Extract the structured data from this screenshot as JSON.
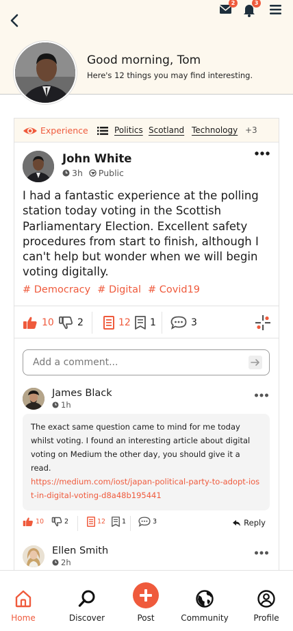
{
  "header": {
    "greeting": "Good morning, Tom",
    "subtitle": "Here's 12 things you may find interesting.",
    "messages_badge": "2",
    "notifications_badge": "3",
    "icons": [
      "back-icon",
      "mail-icon",
      "bell-icon",
      "menu-icon"
    ]
  },
  "filters": {
    "view_label": "Experience",
    "tags": [
      "Politics",
      "Scotland",
      "Technology"
    ],
    "more": "+3"
  },
  "post": {
    "author": "John White",
    "time": "3h",
    "visibility": "Public",
    "text": "I had a fantastic experience at the polling station today voting in the Scottish Parliamentary Election. Excellent safety procedures from start to finish, although I can't help but wonder when we will begin voting digitally.",
    "hashtags": [
      "# Democracy",
      "# Digital",
      "# Covid19"
    ],
    "likes": "10",
    "dislikes": "2",
    "saves": "12",
    "archives": "1",
    "comments": "3"
  },
  "comment_input": {
    "placeholder": "Add a comment..."
  },
  "comments": [
    {
      "author": "James Black",
      "time": "1h",
      "text": "The exact same question came to mind for me today whilst voting. I found an interesting article about digital voting on Medium the other day, you should give it a read.",
      "link": "https://medium.com/iost/japan-political-party-to-adopt-iost-in-digital-voting-d8a48b195441",
      "likes": "10",
      "dislikes": "2",
      "saves": "12",
      "archives": "1",
      "comments": "3",
      "reply_label": "Reply"
    },
    {
      "author": "Ellen Smith",
      "time": "2h"
    }
  ],
  "nav": [
    {
      "label": "Home",
      "icon": "home-icon"
    },
    {
      "label": "Discover",
      "icon": "search-icon"
    },
    {
      "label": "Post",
      "icon": "plus-icon"
    },
    {
      "label": "Community",
      "icon": "globe-icon"
    },
    {
      "label": "Profile",
      "icon": "user-icon"
    }
  ],
  "colors": {
    "accent": "#ef5a3c",
    "header_bg": "#fdf8ee",
    "text": "#1b1b1b"
  }
}
